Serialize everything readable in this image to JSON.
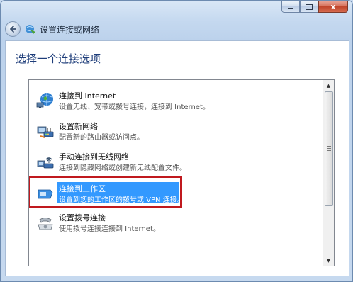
{
  "window": {
    "title": "设置连接或网络",
    "caption_buttons": {
      "minimize": "minimize",
      "maximize": "maximize",
      "close": "x"
    }
  },
  "main": {
    "heading": "选择一个连接选项",
    "options": [
      {
        "title": "连接到 Internet",
        "description": "设置无线、宽带或拨号连接，连接到 Internet。",
        "icon": "globe-network-icon"
      },
      {
        "title": "设置新网络",
        "description": "配置新的路由器或访问点。",
        "icon": "router-icon"
      },
      {
        "title": "手动连接到无线网络",
        "description": "连接到隐藏网络或创建新无线配置文件。",
        "icon": "wireless-icon"
      },
      {
        "title": "连接到工作区",
        "description": "设置到您的工作区的拨号或 VPN 连接。",
        "icon": "workplace-icon",
        "selected": true
      },
      {
        "title": "设置拨号连接",
        "description": "使用拨号连接连接到 Internet。",
        "icon": "dialup-phone-icon"
      }
    ]
  },
  "colors": {
    "selection": "#3399ff",
    "highlight_box": "#c0191e",
    "heading": "#1e3d7a"
  }
}
